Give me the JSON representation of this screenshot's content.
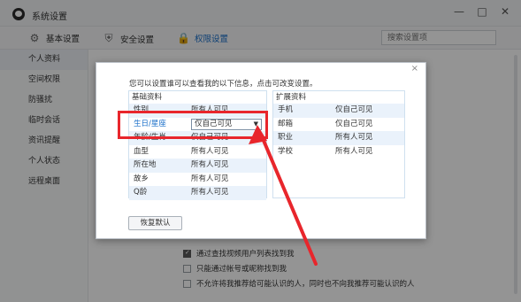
{
  "window": {
    "title": "系统设置",
    "controls": [
      "—",
      "□",
      "✕"
    ]
  },
  "toolbar": {
    "tabs": [
      {
        "label": "基本设置",
        "icon": "gear-icon"
      },
      {
        "label": "安全设置",
        "icon": "shield-icon"
      },
      {
        "label": "权限设置",
        "icon": "lock-icon"
      }
    ],
    "search_placeholder": "搜索设置项"
  },
  "sidebar": {
    "items": [
      {
        "label": "个人资料"
      },
      {
        "label": "空间权限"
      },
      {
        "label": "防骚扰"
      },
      {
        "label": "临时会话"
      },
      {
        "label": "资讯提醒"
      },
      {
        "label": "个人状态"
      },
      {
        "label": "远程桌面"
      }
    ]
  },
  "background_options": [
    {
      "label": "通过查找视频用户列表找到我",
      "checked": true
    },
    {
      "label": "只能通过帐号或昵称找到我",
      "checked": false
    },
    {
      "label": "不允许将我推荐给可能认识的人，同时也不向我推荐可能认识的人",
      "checked": false
    }
  ],
  "dialog": {
    "close": "×",
    "intro": "您可以设置谁可以查看我的以下信息，点击可改变设置。",
    "left_panel": {
      "title": "基础资料",
      "rows": [
        {
          "key": "性别",
          "value": "所有人可见"
        },
        {
          "key": "生日/星座",
          "value": "仅自己可见"
        },
        {
          "key": "年龄/生肖",
          "value": "仅自己可见"
        },
        {
          "key": "血型",
          "value": "所有人可见"
        },
        {
          "key": "所在地",
          "value": "所有人可见"
        },
        {
          "key": "故乡",
          "value": "所有人可见"
        },
        {
          "key": "Q龄",
          "value": "所有人可见"
        }
      ]
    },
    "right_panel": {
      "title": "扩展资料",
      "rows": [
        {
          "key": "手机",
          "value": "仅自己可见"
        },
        {
          "key": "邮箱",
          "value": "仅自己可见"
        },
        {
          "key": "职业",
          "value": "所有人可见"
        },
        {
          "key": "学校",
          "value": "所有人可见"
        }
      ]
    },
    "restore_label": "恢复默认"
  },
  "annotation_color": "#e8262c"
}
